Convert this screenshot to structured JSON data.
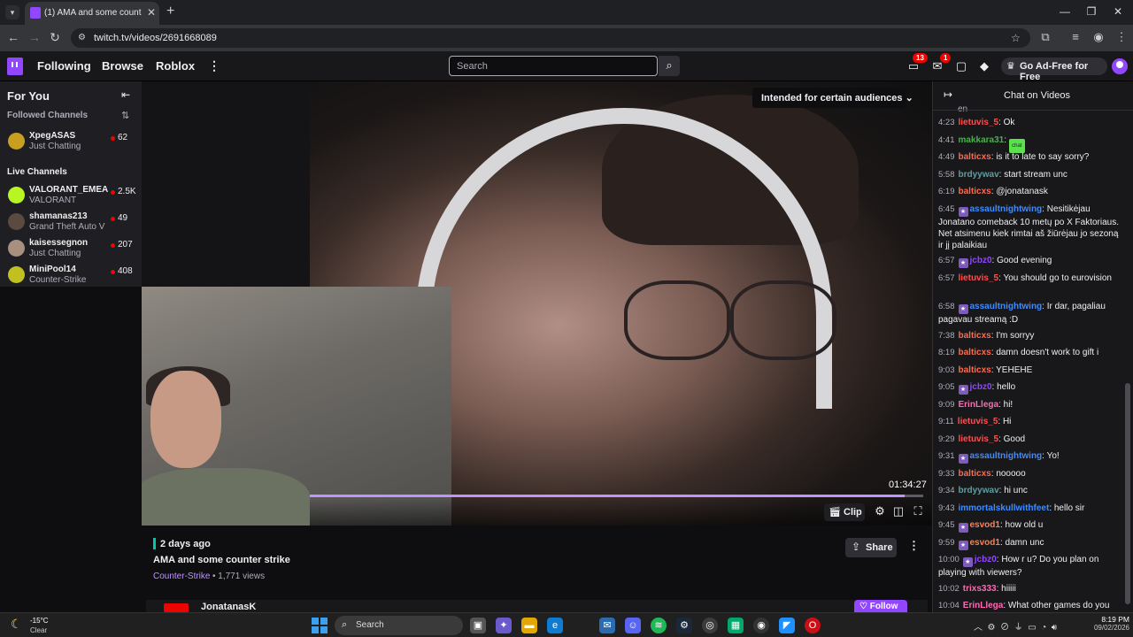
{
  "browser": {
    "tab_title": "(1) AMA and some counter strike",
    "url": "twitch.tv/videos/2691668089",
    "new_tab": "+"
  },
  "nav": {
    "following": "Following",
    "browse": "Browse",
    "roblox": "Roblox",
    "search_placeholder": "Search",
    "inbox_badge": "13",
    "whispers_badge": "1",
    "ad_free": "Go Ad-Free for Free"
  },
  "sidebar": {
    "title": "For You",
    "followed_label": "Followed Channels",
    "live_label": "Live Channels",
    "followed": [
      {
        "name": "XpegASAS",
        "game": "Just Chatting",
        "viewers": "62",
        "color": "#c8a020"
      }
    ],
    "live": [
      {
        "name": "VALORANT_EMEA",
        "game": "VALORANT",
        "viewers": "2.5K",
        "color": "#b9f522"
      },
      {
        "name": "shamanas213",
        "game": "Grand Theft Auto V",
        "viewers": "49",
        "color": "#5a4a40"
      },
      {
        "name": "kaisessegnon",
        "game": "Just Chatting",
        "viewers": "207",
        "color": "#a89080"
      },
      {
        "name": "MiniPool14",
        "game": "Counter-Strike",
        "viewers": "408",
        "color": "#c0c020"
      }
    ]
  },
  "video": {
    "audience_label": "Intended for certain audiences",
    "timestamp": "01:34:27",
    "clip_label": "Clip",
    "progress_fraction": 0.97
  },
  "info": {
    "date": "2 days ago",
    "title": "AMA and some counter strike",
    "category": "Counter-Strike",
    "views": " • 1,771 views",
    "share_label": "Share",
    "channel_name": "JonatanasK",
    "follow_label": "Follow"
  },
  "chat": {
    "title": "Chat on Videos",
    "partial_top": "en",
    "messages": [
      {
        "time": "4:23",
        "user": "lietuvis_5",
        "color": "#ff4f4f",
        "text": "Ok"
      },
      {
        "time": "4:41",
        "user": "makkara31",
        "color": "#4caf50",
        "text": "",
        "emote": "chat"
      },
      {
        "time": "4:49",
        "user": "balticxs",
        "color": "#ff6a4d",
        "text": "is it to late to say sorry?"
      },
      {
        "time": "5:58",
        "user": "brdyywav",
        "color": "#5f9ea0",
        "text": "start stream unc"
      },
      {
        "time": "6:19",
        "user": "balticxs",
        "color": "#ff6a4d",
        "text": "@jonatanask"
      },
      {
        "time": "6:45",
        "user": "assaultnightwing",
        "color": "#3f8cff",
        "text": "Nesitikėjau Jonatano comeback 10 metų po X Faktoriaus. Net atsimenu kiek rimtai aš žiūrėjau jo sezoną ir jį palaikiau",
        "badge": true
      },
      {
        "time": "6:57",
        "user": "jcbz0",
        "color": "#9146ff",
        "text": "Good evening",
        "badge": true
      },
      {
        "time": "6:57",
        "user": "lietuvis_5",
        "color": "#ff4f4f",
        "text": "You should go to eurovision"
      },
      {
        "time": "6:58",
        "user": "assaultnightwing",
        "color": "#3f8cff",
        "text": "Ir dar, pagaliau pagavau streamą :D",
        "badge": true
      },
      {
        "time": "7:38",
        "user": "balticxs",
        "color": "#ff6a4d",
        "text": "I'm sorryy"
      },
      {
        "time": "8:19",
        "user": "balticxs",
        "color": "#ff6a4d",
        "text": "damn doesn't work to gift i"
      },
      {
        "time": "9:03",
        "user": "balticxs",
        "color": "#ff6a4d",
        "text": "YEHEHE"
      },
      {
        "time": "9:05",
        "user": "jcbz0",
        "color": "#9146ff",
        "text": "hello",
        "badge": true
      },
      {
        "time": "9:09",
        "user": "ErinLlega",
        "color": "#ff69b4",
        "text": "hi!"
      },
      {
        "time": "9:11",
        "user": "lietuvis_5",
        "color": "#ff4f4f",
        "text": "Hi"
      },
      {
        "time": "9:29",
        "user": "lietuvis_5",
        "color": "#ff4f4f",
        "text": "Good"
      },
      {
        "time": "9:31",
        "user": "assaultnightwing",
        "color": "#3f8cff",
        "text": "Yo!",
        "badge": true
      },
      {
        "time": "9:33",
        "user": "balticxs",
        "color": "#ff6a4d",
        "text": "nooooo"
      },
      {
        "time": "9:34",
        "user": "brdyywav",
        "color": "#5f9ea0",
        "text": "hi unc"
      },
      {
        "time": "9:43",
        "user": "immortalskullwithfeet",
        "color": "#3f8cff",
        "text": "hello sir"
      },
      {
        "time": "9:45",
        "user": "esvod1",
        "color": "#ff7f50",
        "text": "how old u",
        "badge": true
      },
      {
        "time": "9:59",
        "user": "esvod1",
        "color": "#ff7f50",
        "text": "damn unc",
        "badge": true
      },
      {
        "time": "10:00",
        "user": "jcbz0",
        "color": "#9146ff",
        "text": "How r u? Do you plan on playing with viewers?",
        "badge": true
      },
      {
        "time": "10:02",
        "user": "trixs333",
        "color": "#ff69b4",
        "text": "hiiiii"
      },
      {
        "time": "10:04",
        "user": "ErinLlega",
        "color": "#ff69b4",
        "text": "What other games do you play?"
      }
    ]
  },
  "taskbar": {
    "temp": "-15°C",
    "condition": "Clear",
    "search_label": "Search",
    "time": "8:19 PM",
    "date": "09/02/2026"
  }
}
